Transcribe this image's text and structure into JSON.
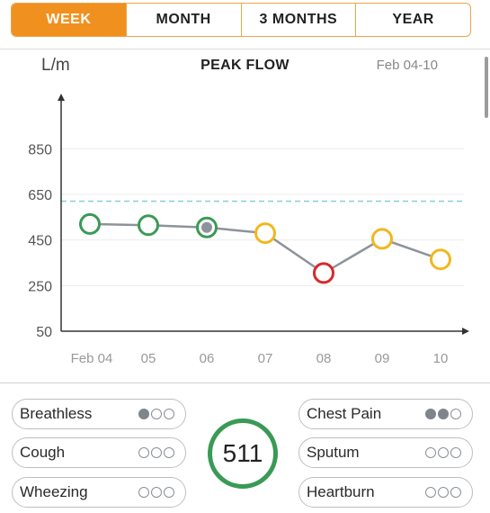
{
  "tabs": [
    {
      "label": "WEEK",
      "active": true
    },
    {
      "label": "MONTH",
      "active": false
    },
    {
      "label": "3 MONTHS",
      "active": false
    },
    {
      "label": "YEAR",
      "active": false
    }
  ],
  "chart_header": {
    "unit": "L/m",
    "title": "PEAK FLOW",
    "date_range": "Feb 04-10"
  },
  "chart_data": {
    "type": "line",
    "title": "PEAK FLOW",
    "ylabel": "L/m",
    "ylim": [
      50,
      950
    ],
    "yticks": [
      850,
      650,
      450,
      250,
      50
    ],
    "reference_line": 620,
    "categories": [
      "Feb 04",
      "05",
      "06",
      "07",
      "08",
      "09",
      "10"
    ],
    "values": [
      520,
      515,
      505,
      480,
      305,
      455,
      365
    ],
    "point_status": [
      "green",
      "green",
      "green-selected",
      "yellow",
      "red",
      "yellow",
      "yellow"
    ],
    "grid": true
  },
  "colors": {
    "accent": "#f0901e",
    "green": "#3a9a55",
    "yellow": "#f2b71e",
    "red": "#d62a2a",
    "line": "#8d939a",
    "reference": "#8fd0da"
  },
  "symptoms": {
    "left": [
      {
        "label": "Breathless",
        "level": 1
      },
      {
        "label": "Cough",
        "level": 0
      },
      {
        "label": "Wheezing",
        "level": 0
      }
    ],
    "right": [
      {
        "label": "Chest Pain",
        "level": 2
      },
      {
        "label": "Sputum",
        "level": 0
      },
      {
        "label": "Heartburn",
        "level": 0
      }
    ]
  },
  "score": "511"
}
